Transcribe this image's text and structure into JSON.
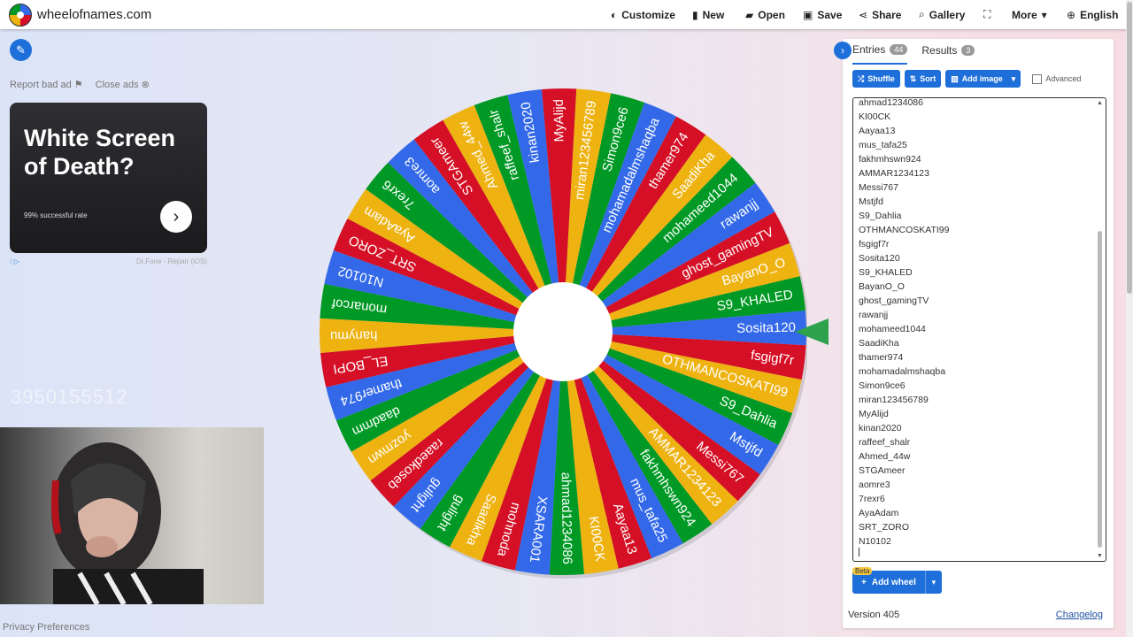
{
  "topbar": {
    "site_title": "wheelofnames.com",
    "nav": [
      {
        "icon": "palette-icon",
        "glyph": "◐",
        "label": "Customize"
      },
      {
        "icon": "new-file-icon",
        "glyph": "▮",
        "label": "New"
      },
      {
        "icon": "folder-open-icon",
        "glyph": "▰",
        "label": "Open"
      },
      {
        "icon": "save-icon",
        "glyph": "▣",
        "label": "Save"
      },
      {
        "icon": "share-icon",
        "glyph": "⋖",
        "label": "Share"
      },
      {
        "icon": "search-icon",
        "glyph": "⌕",
        "label": "Gallery"
      },
      {
        "icon": "fullscreen-icon",
        "glyph": "⛶",
        "label": ""
      },
      {
        "icon": "chevron-down-icon",
        "glyph": "",
        "label": "More"
      },
      {
        "icon": "globe-icon",
        "glyph": "⊕",
        "label": "English"
      }
    ]
  },
  "ad": {
    "report_label": "Report bad ad",
    "close_label": "Close ads",
    "title": "White Screen of Death?",
    "subtitle": "99% successful rate",
    "source": "Dr.Fone - Repair (iOS)"
  },
  "overlay_number": "3950155512",
  "privacy_label": "Privacy Preferences",
  "wheel": {
    "colors": [
      "#3369e8",
      "#d50f25",
      "#eeb211",
      "#009925"
    ],
    "pointer_color": "#2da14c",
    "start_segment": "Sosita120",
    "labels": [
      "Sosita120",
      "fsgigf7r",
      "OTHMANCOSKATI99",
      "S9_Dahlia",
      "Mstjfd",
      "Messi767",
      "AMMAR1234123",
      "fakhmhswn924",
      "mus_tafa25",
      "Aayaa13",
      "KI00CK",
      "ahmad1234086",
      "XSARA001",
      "mohnoda",
      "Saadikha",
      "gulight",
      "gulight",
      "raaedkoseb",
      "yozmwn",
      "daadmm",
      "thamer974",
      "EL_BOPI",
      "hanymu",
      "monarcof",
      "N10102",
      "SRT_ZORO",
      "AyaAdam",
      "7rexr6",
      "aomre3",
      "STGAmeer",
      "Ahmed_44w",
      "raffeef_shalr",
      "kinan2020",
      "MyAlijd",
      "miran123456789",
      "Simon9ce6",
      "mohamadalmshaqba",
      "thamer974",
      "SaadiKha",
      "mohameed1044",
      "rawanjj",
      "ghost_gamingTV",
      "BayanO_O",
      "S9_KHALED"
    ]
  },
  "panel": {
    "tabs": [
      {
        "label": "Entries",
        "count": "44"
      },
      {
        "label": "Results",
        "count": "3"
      }
    ],
    "shuffle_label": "Shuffle",
    "sort_label": "Sort",
    "add_image_label": "Add image",
    "advanced_label": "Advanced",
    "entries": [
      "ahmad1234086",
      "KI00CK",
      "Aayaa13",
      "mus_tafa25",
      "fakhmhswn924",
      "AMMAR1234123",
      "Messi767",
      "Mstjfd",
      "S9_Dahlia",
      "OTHMANCOSKATI99",
      "fsgigf7r",
      "Sosita120",
      "S9_KHALED",
      "BayanO_O",
      "ghost_gamingTV",
      "rawanjj",
      "mohameed1044",
      "SaadiKha",
      "thamer974",
      "mohamadalmshaqba",
      "Simon9ce6",
      "miran123456789",
      "MyAlijd",
      "kinan2020",
      "raffeef_shalr",
      "Ahmed_44w",
      "STGAmeer",
      "aomre3",
      "7rexr6",
      "AyaAdam",
      "SRT_ZORO",
      "N10102"
    ],
    "beta_label": "Beta",
    "add_wheel_label": "Add wheel",
    "version_label": "Version 405",
    "changelog_label": "Changelog"
  }
}
